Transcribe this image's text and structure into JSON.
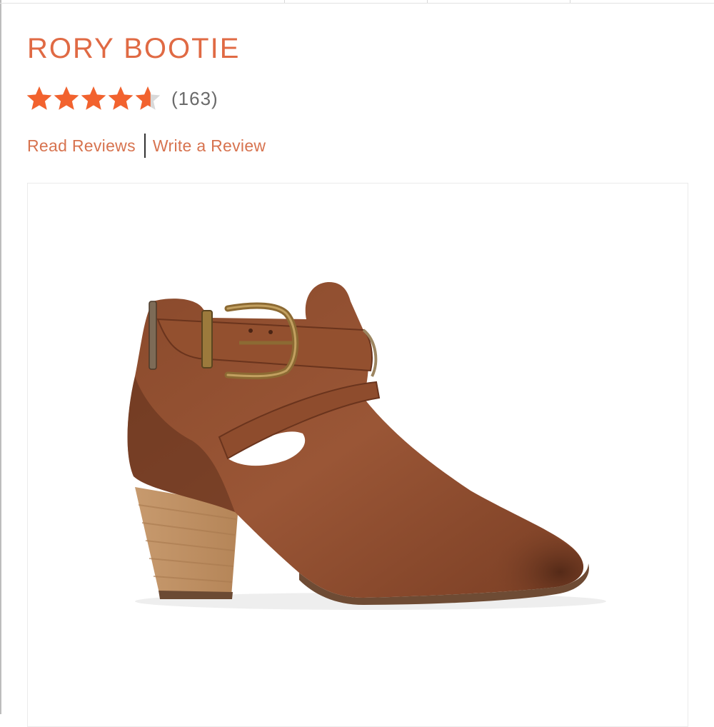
{
  "product": {
    "title": "RORY BOOTIE",
    "rating": {
      "stars_value": 4.6,
      "stars_max": 5,
      "count_label": "(163)"
    },
    "links": {
      "read_reviews": "Read Reviews",
      "write_review": "Write a Review"
    },
    "image": {
      "subject": "brown leather ankle bootie with buckle strap and stacked heel"
    }
  },
  "colors": {
    "accent": "#e06a44",
    "star_fill": "#f2622e",
    "star_empty": "#d9d9d9"
  }
}
